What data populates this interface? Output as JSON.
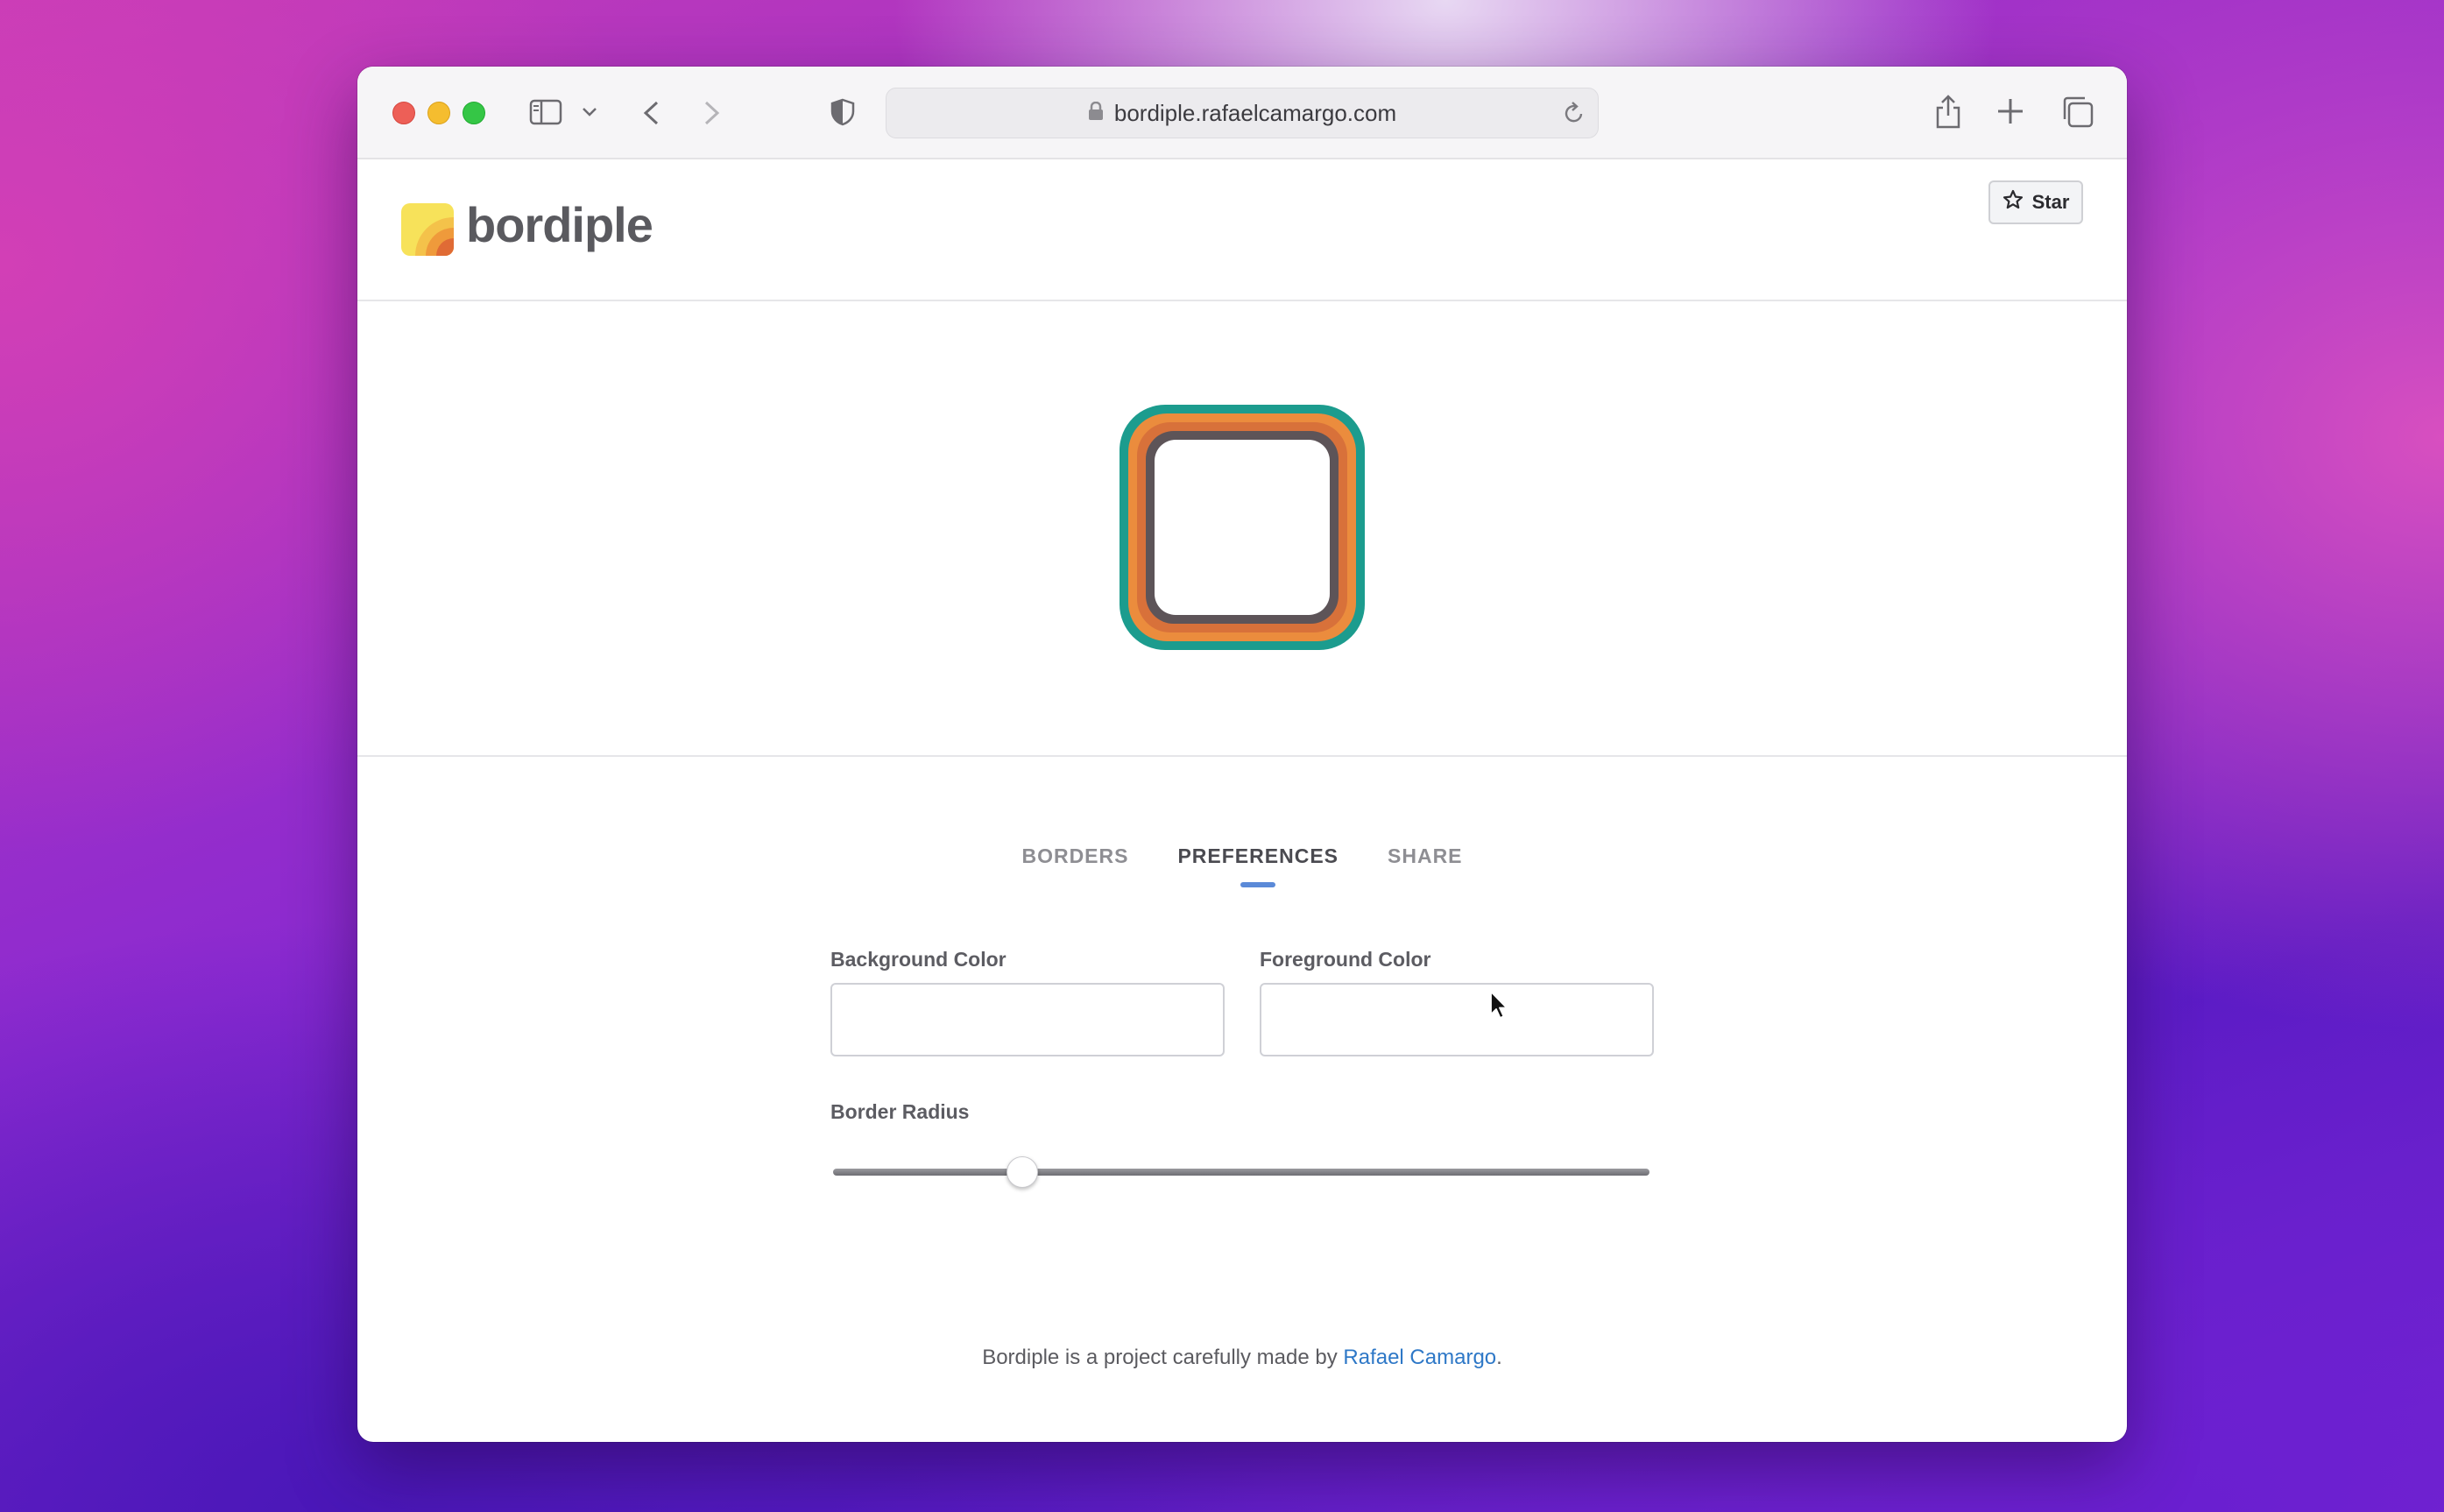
{
  "browser": {
    "url": "bordiple.rafaelcamargo.com"
  },
  "site": {
    "logo_text": "bordiple",
    "star_label": "Star"
  },
  "preview": {
    "colors": [
      "#1c9c8e",
      "#eb8c3d",
      "#d8713a",
      "#5d5458"
    ],
    "background": "#ffffff"
  },
  "tabs": [
    {
      "label": "BORDERS",
      "active": false
    },
    {
      "label": "PREFERENCES",
      "active": true
    },
    {
      "label": "SHARE",
      "active": false
    }
  ],
  "preferences": {
    "background_color_label": "Background Color",
    "background_color_value": "",
    "foreground_color_label": "Foreground Color",
    "foreground_color_value": "",
    "border_radius_label": "Border Radius",
    "border_radius_fraction": 0.22
  },
  "footer": {
    "text": "Bordiple is a project carefully made by ",
    "link_text": "Rafael Camargo",
    "suffix": "."
  }
}
